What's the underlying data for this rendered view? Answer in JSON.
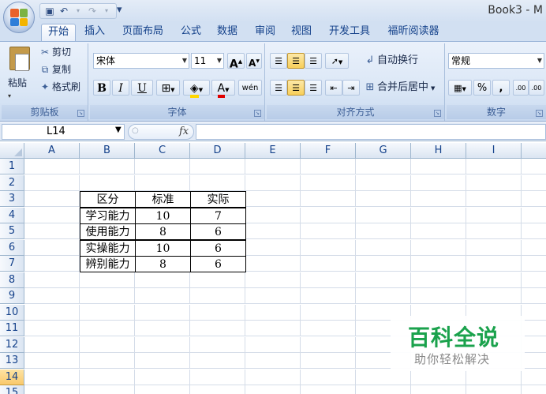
{
  "app": {
    "title": "Book3 - M",
    "qat": {
      "undo_icon": "undo-icon",
      "redo_icon": "redo-icon",
      "save_icon": "save-icon",
      "customize": "▾"
    }
  },
  "tabs": [
    {
      "label": "开始",
      "active": true
    },
    {
      "label": "插入",
      "active": false
    },
    {
      "label": "页面布局",
      "active": false
    },
    {
      "label": "公式",
      "active": false
    },
    {
      "label": "数据",
      "active": false
    },
    {
      "label": "审阅",
      "active": false
    },
    {
      "label": "视图",
      "active": false
    },
    {
      "label": "开发工具",
      "active": false
    },
    {
      "label": "福昕阅读器",
      "active": false
    }
  ],
  "ribbon": {
    "clipboard": {
      "label": "剪贴板",
      "paste": "粘贴",
      "cut": "剪切",
      "copy": "复制",
      "format_painter": "格式刷"
    },
    "font": {
      "label": "字体",
      "font_name": "宋体",
      "font_size": "11",
      "bold": "B",
      "italic": "I",
      "underline": "U",
      "grow": "A",
      "shrink": "A",
      "phonetic": "wén"
    },
    "alignment": {
      "label": "对齐方式",
      "wrap_text": "自动换行",
      "merge_center": "合并后居中"
    },
    "number": {
      "label": "数字",
      "format": "常规",
      "percent": "%",
      "comma": ",",
      "inc_decimal": ".00",
      "dec_decimal": ".00"
    }
  },
  "formula_bar": {
    "name_box": "L14",
    "fx": "fx",
    "formula": ""
  },
  "sheet": {
    "columns": [
      "A",
      "B",
      "C",
      "D",
      "E",
      "F",
      "G",
      "H",
      "I"
    ],
    "rows": [
      "1",
      "2",
      "3",
      "4",
      "5",
      "6",
      "7",
      "8",
      "9",
      "10",
      "11",
      "12",
      "13",
      "14",
      "15"
    ],
    "selected_row": "14",
    "table": {
      "headers": [
        "区分",
        "标准",
        "实际"
      ],
      "rows": [
        [
          "学习能力",
          "10",
          "7"
        ],
        [
          "使用能力",
          "8",
          "6"
        ],
        [
          "实操能力",
          "10",
          "6"
        ],
        [
          "辨别能力",
          "8",
          "6"
        ]
      ]
    }
  },
  "watermark": {
    "title": "百科全说",
    "subtitle": "助你轻松解决"
  },
  "colors": {
    "accent": "#15428b",
    "watermark_green": "#1aa24c",
    "selected_row": "#f9c96c"
  }
}
